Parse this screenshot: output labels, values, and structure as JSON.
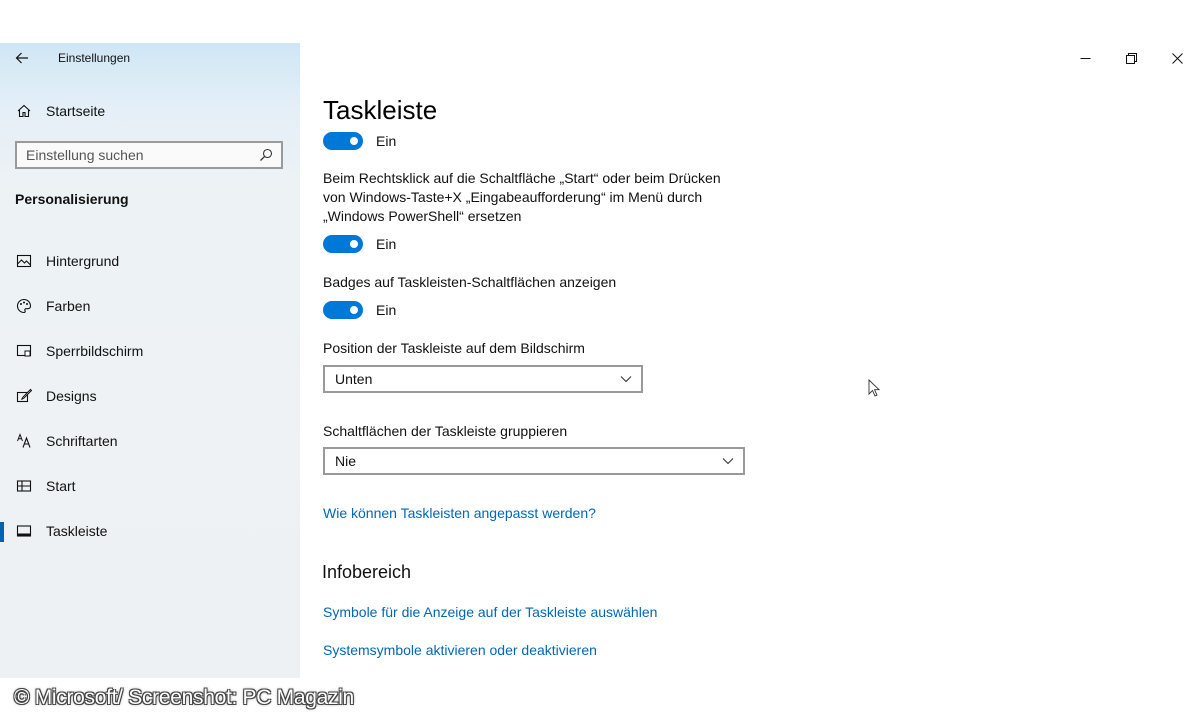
{
  "app": {
    "title": "Einstellungen"
  },
  "sidebar": {
    "home_label": "Startseite",
    "search": {
      "placeholder": "Einstellung suchen"
    },
    "section_label": "Personalisierung",
    "items": [
      {
        "label": "Hintergrund",
        "icon": "image-icon"
      },
      {
        "label": "Farben",
        "icon": "palette-icon"
      },
      {
        "label": "Sperrbildschirm",
        "icon": "lock-screen-icon"
      },
      {
        "label": "Designs",
        "icon": "brush-icon"
      },
      {
        "label": "Schriftarten",
        "icon": "font-icon"
      },
      {
        "label": "Start",
        "icon": "start-menu-icon"
      },
      {
        "label": "Taskleiste",
        "icon": "taskbar-icon",
        "active": true
      }
    ]
  },
  "main": {
    "title": "Taskleiste",
    "toggle1_label": "Ein",
    "powershell_desc": "Beim Rechtsklick auf die Schaltfläche „Start“ oder beim Drücken von Windows-Taste+X „Eingabeaufforderung“ im Menü durch „Windows PowerShell“ ersetzen",
    "toggle2_label": "Ein",
    "badges_desc": "Badges auf Taskleisten-Schaltflächen anzeigen",
    "toggle3_label": "Ein",
    "position_label": "Position der Taskleiste auf dem Bildschirm",
    "position_value": "Unten",
    "group_label": "Schaltflächen der Taskleiste gruppieren",
    "group_value": "Nie",
    "help_link": "Wie können Taskleisten angepasst werden?",
    "info_heading": "Infobereich",
    "info_link1": "Symbole für die Anzeige auf der Taskleiste auswählen",
    "info_link2": "Systemsymbole aktivieren oder deaktivieren"
  },
  "watermark": "© Microsoft/ Screenshot: PC Magazin",
  "colors": {
    "accent": "#0078d7",
    "link": "#0067b8"
  }
}
